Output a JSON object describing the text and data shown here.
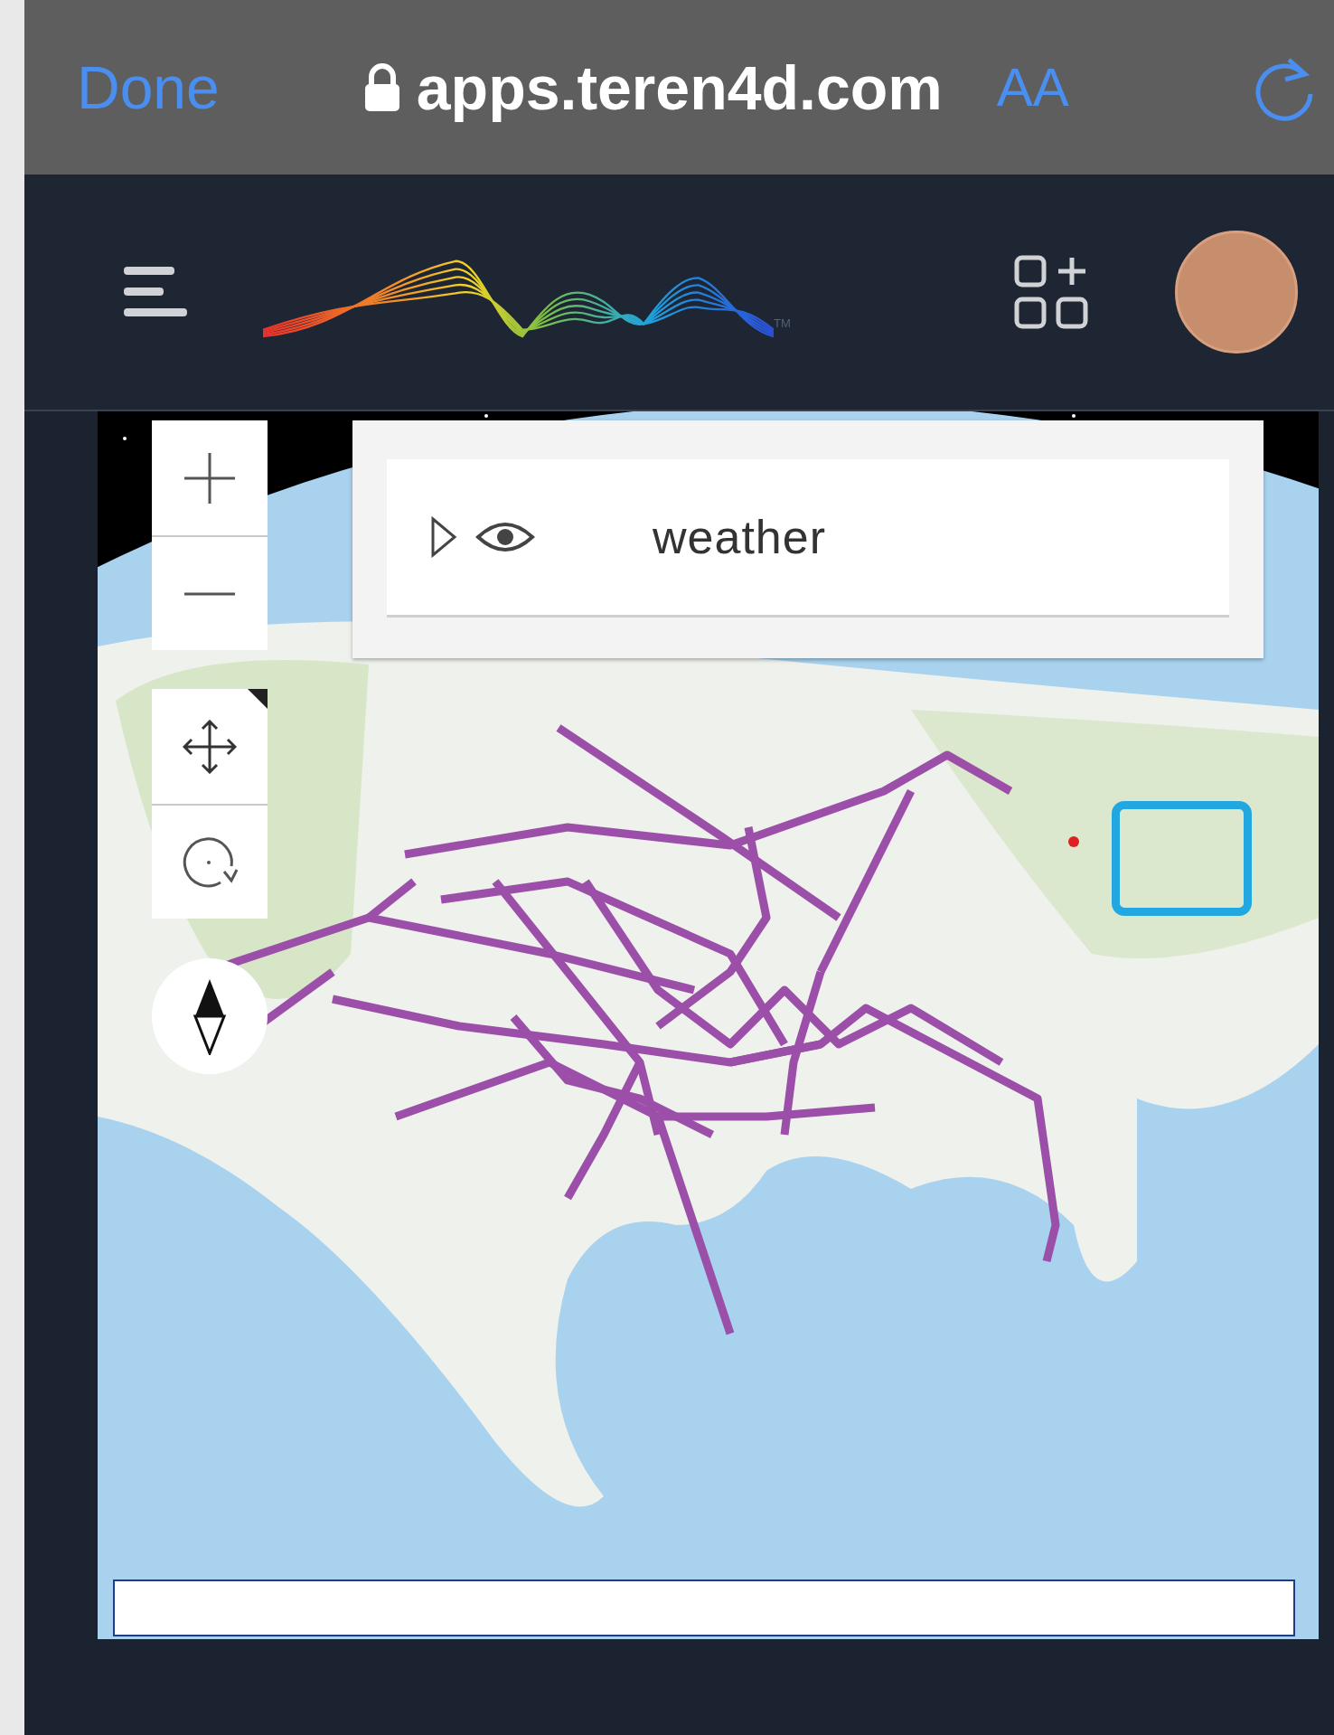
{
  "browser_bar": {
    "done": "Done",
    "url": "apps.teren4d.com",
    "text_size": "AA"
  },
  "app_header": {
    "trademark": "TM"
  },
  "layers": [
    {
      "name": "weather",
      "expanded": false,
      "visible": true
    }
  ]
}
